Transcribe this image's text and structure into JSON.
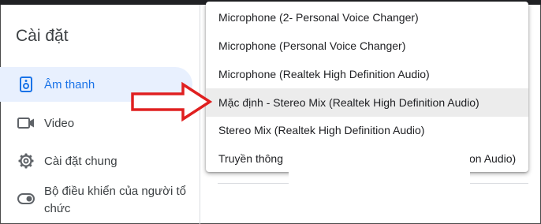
{
  "settings": {
    "title": "Cài đặt",
    "nav": [
      {
        "label": "Âm thanh",
        "icon": "speaker-icon",
        "active": true
      },
      {
        "label": "Video",
        "icon": "video-camera-icon"
      },
      {
        "label": "Cài đặt chung",
        "icon": "gear-icon"
      },
      {
        "label": "Bộ điều khiển của người tổ chức",
        "icon": "toggle-icon"
      }
    ]
  },
  "microphone_menu": {
    "items": [
      {
        "label": "Microphone (2- Personal Voice Changer)"
      },
      {
        "label": "Microphone (Personal Voice Changer)"
      },
      {
        "label": "Microphone (Realtek High Definition Audio)"
      },
      {
        "label": "Mặc định - Stereo Mix (Realtek High Definition Audio)",
        "selected": true
      },
      {
        "label": "Stereo Mix (Realtek High Definition Audio)"
      },
      {
        "label": "Truyền thông",
        "tail": "on Audio)"
      }
    ]
  },
  "colors": {
    "accent": "#1a73e8",
    "active_bg": "#e8f0fe",
    "arrow": "#e02020"
  }
}
